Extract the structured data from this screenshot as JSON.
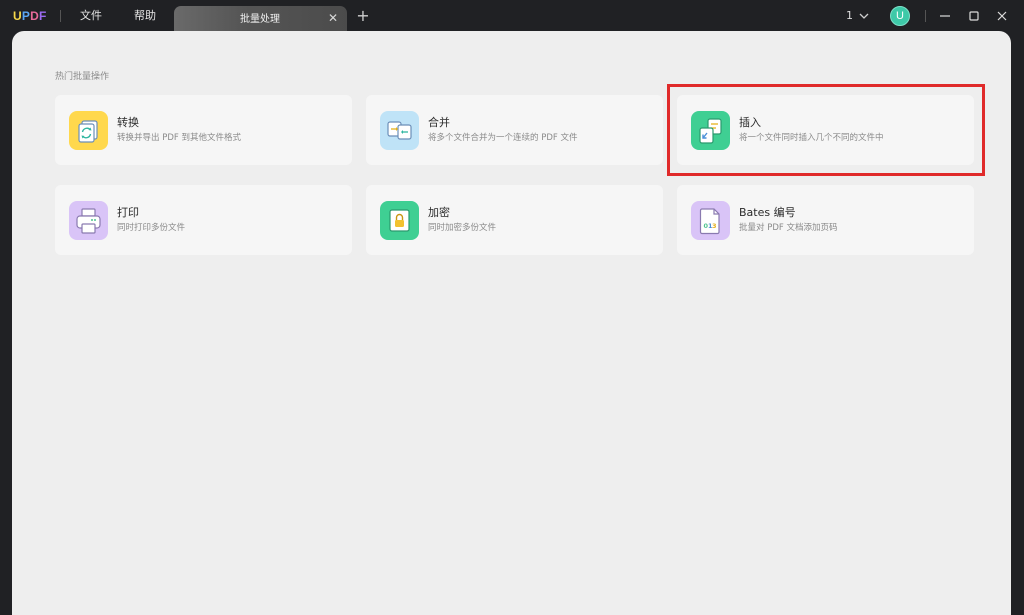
{
  "app": {
    "logo_letters": [
      "U",
      "P",
      "D",
      "F"
    ],
    "logo_colors": [
      "#f6d84a",
      "#5aa6f5",
      "#e86a9a",
      "#9b6bf2"
    ]
  },
  "menu": {
    "file": "文件",
    "help": "帮助"
  },
  "tab": {
    "label": "批量处理",
    "close_glyph": "✕",
    "add_glyph": "+"
  },
  "toolbar": {
    "page_count": "1",
    "avatar_letter": "U",
    "accent": "#3ec9a8"
  },
  "section": {
    "title": "热门批量操作"
  },
  "cards": [
    {
      "icon": "convert-icon",
      "title": "转换",
      "desc": "转换并导出 PDF 到其他文件格式",
      "color": "#ffd84d"
    },
    {
      "icon": "merge-icon",
      "title": "合并",
      "desc": "将多个文件合并为一个连续的 PDF 文件",
      "color": "#bfe3f7"
    },
    {
      "icon": "insert-icon",
      "title": "插入",
      "desc": "将一个文件同时插入几个不同的文件中",
      "color": "#3fcf93"
    },
    {
      "icon": "print-icon",
      "title": "打印",
      "desc": "同时打印多份文件",
      "color": "#d9c4f7"
    },
    {
      "icon": "encrypt-icon",
      "title": "加密",
      "desc": "同时加密多份文件",
      "color": "#3fcf93"
    },
    {
      "icon": "bates-icon",
      "title": "Bates 编号",
      "desc": "批量对 PDF 文档添加页码",
      "color": "#d9c4f7"
    }
  ],
  "highlight_color": "#e02a2a"
}
